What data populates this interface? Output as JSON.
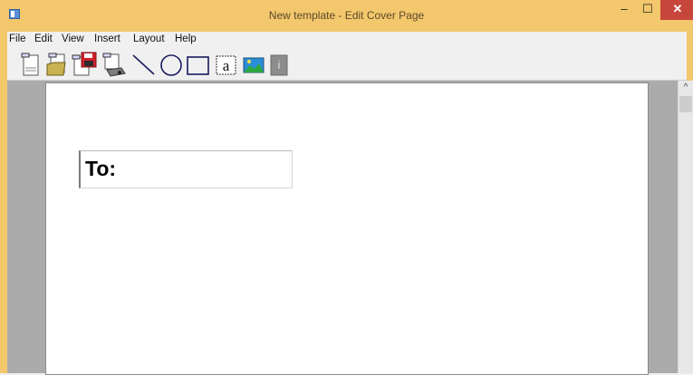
{
  "window": {
    "title": "New template - Edit Cover Page",
    "buttons": {
      "minimize": "–",
      "maximize": "☐",
      "close": "✕"
    }
  },
  "menu": [
    "File",
    "Edit",
    "View",
    "Insert",
    "Layout",
    "Help"
  ],
  "toolbar": {
    "tools": [
      "new-template-icon",
      "open-template-icon",
      "save-template-icon",
      "fax-preview-icon",
      "line-tool-icon",
      "ellipse-tool-icon",
      "rectangle-tool-icon",
      "text-tool-icon",
      "image-tool-icon",
      "info-icon"
    ],
    "text_tool_glyph": "a",
    "info_glyph": "i"
  },
  "page": {
    "field_label": "To:"
  },
  "scrollbar": {
    "up_arrow": "^"
  },
  "colors": {
    "titlebar": "#f3c76c",
    "close_button": "#c7463b",
    "workspace": "#ababab",
    "page": "#ffffff"
  }
}
